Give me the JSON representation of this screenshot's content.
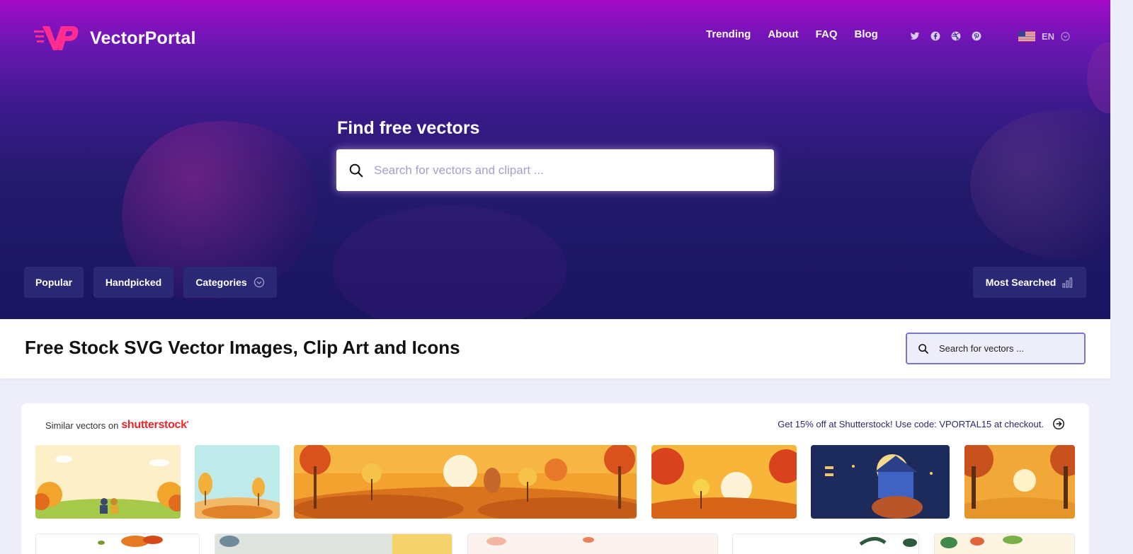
{
  "brand": {
    "name": "VectorPortal",
    "accent": "#ff2d8f"
  },
  "nav": {
    "items": [
      "Trending",
      "About",
      "FAQ",
      "Blog"
    ]
  },
  "social": [
    "twitter-icon",
    "facebook-icon",
    "dribbble-icon",
    "pinterest-icon"
  ],
  "language": {
    "code": "EN"
  },
  "hero": {
    "title": "Find free vectors",
    "search_placeholder": "Search for vectors and clipart ..."
  },
  "filters": {
    "popular": "Popular",
    "handpicked": "Handpicked",
    "categories": "Categories",
    "most_searched": "Most Searched"
  },
  "page": {
    "heading": "Free Stock SVG Vector Images, Clip Art and Icons",
    "search_placeholder": "Search for vectors ..."
  },
  "similar": {
    "label": "Similar vectors on",
    "partner": "shutterstock",
    "promo": "Get 15% off at Shutterstock! Use code: VPORTAL15 at checkout."
  },
  "colors": {
    "hero_top": "#a30ac8",
    "hero_bottom": "#1a1560",
    "pill_bg": "#2b2876",
    "search_border": "#7a74cc",
    "page_bg": "#eeeefb"
  }
}
